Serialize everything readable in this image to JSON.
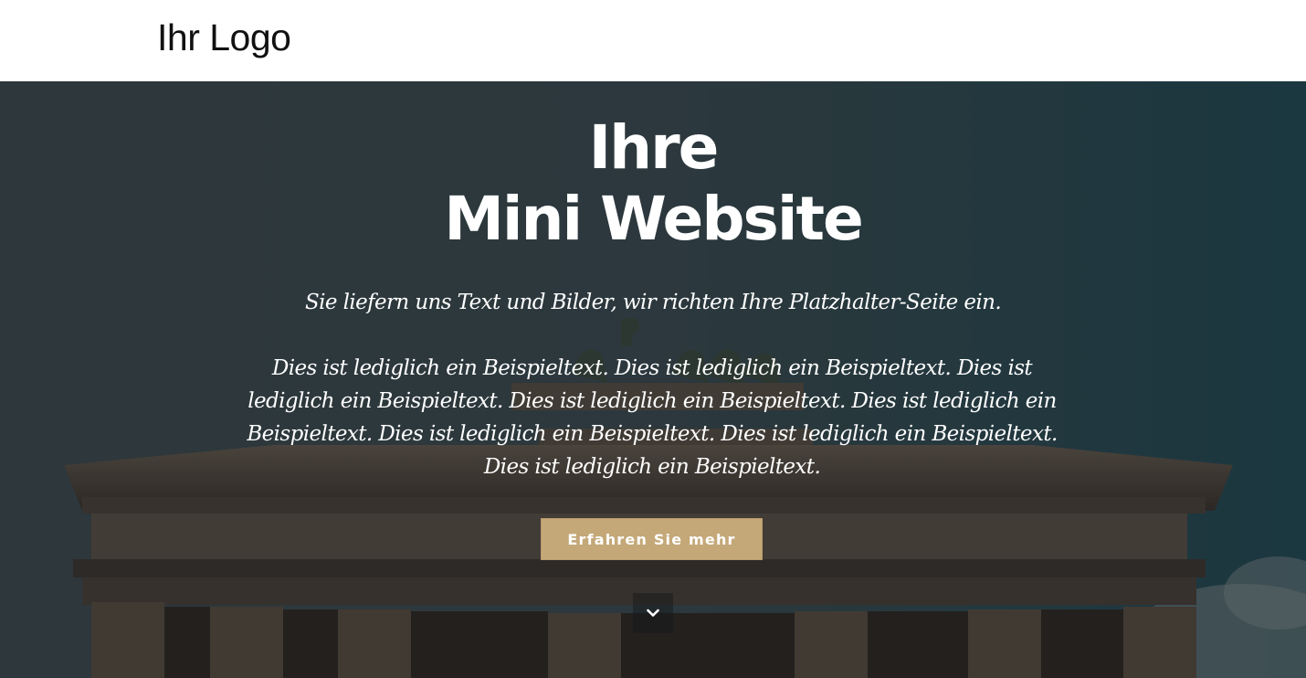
{
  "header": {
    "logo_text": "Ihr Logo"
  },
  "hero": {
    "title_line1": "Ihre",
    "title_line2": "Mini Website",
    "subtitle": "Sie liefern uns Text und Bilder, wir richten Ihre Platzhalter-Seite ein.",
    "body": "Dies ist lediglich ein Beispieltext. Dies ist lediglich ein Beispieltext. Dies ist lediglich ein Beispieltext. Dies ist lediglich ein Beispieltext. Dies ist lediglich ein Beispieltext. Dies ist lediglich ein Beispieltext. Dies ist lediglich ein Beispieltext. Dies ist lediglich ein Beispieltext.",
    "cta_label": "Erfahren Sie mehr",
    "scroll_icon": "chevron-down-icon",
    "background_image": "brandenburg-gate-photo"
  },
  "colors": {
    "cta_background": "#c4a878",
    "text": "#ffffff",
    "header_background": "#ffffff"
  }
}
